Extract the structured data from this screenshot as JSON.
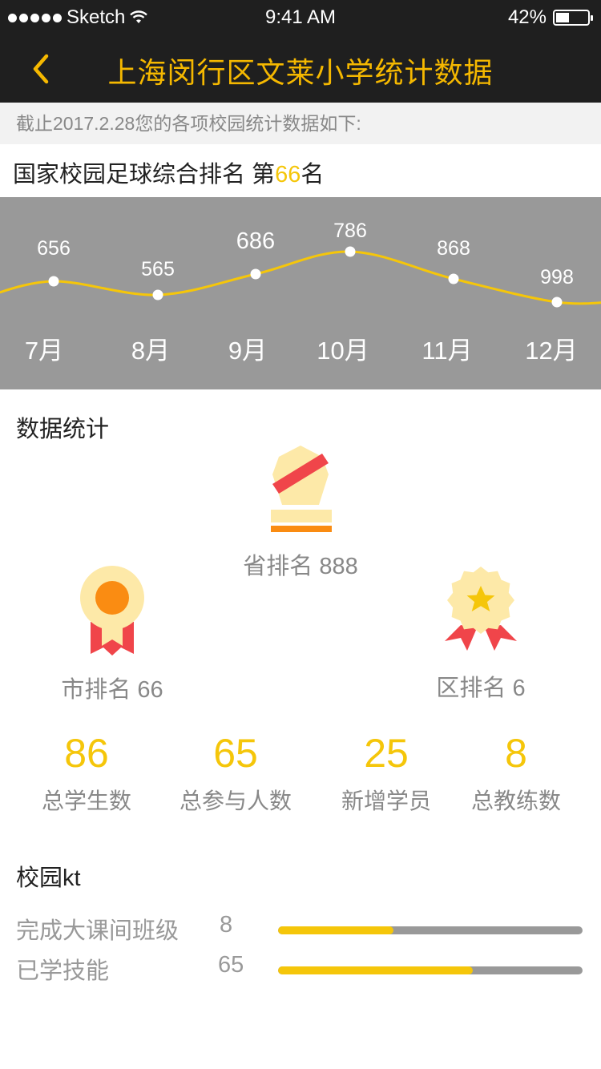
{
  "status": {
    "carrier": "Sketch",
    "time": "9:41 AM",
    "battery": "42%",
    "battery_level": 0.42
  },
  "nav": {
    "title": "上海闵行区文莱小学统计数据"
  },
  "subtitle": "截止2017.2.28您的各项校园统计数据如下:",
  "ranking": {
    "prefix": "国家校园足球综合排名 第",
    "rank": "66",
    "suffix": "名"
  },
  "chart_data": {
    "type": "line",
    "categories": [
      "7月",
      "8月",
      "9月",
      "10月",
      "11月",
      "12月"
    ],
    "values": [
      656,
      565,
      686,
      786,
      868,
      998
    ],
    "data_labels": [
      "656",
      "565",
      "686",
      "786",
      "868",
      "998"
    ]
  },
  "stats_section": {
    "title": "数据统计"
  },
  "awards": {
    "province": {
      "label": "省排名 888"
    },
    "city": {
      "label": "市排名 66"
    },
    "district": {
      "label": "区排名 6"
    }
  },
  "stats": [
    {
      "value": "86",
      "label": "总学生数"
    },
    {
      "value": "65",
      "label": "总参与人数"
    },
    {
      "value": "25",
      "label": "新增学员"
    },
    {
      "value": "8",
      "label": "总教练数"
    }
  ],
  "kt": {
    "title": "校园kt",
    "rows": [
      {
        "name": "完成大课间班级",
        "value": "8",
        "progress": 0.38
      },
      {
        "name": "已学技能",
        "value": "65",
        "progress": 0.64
      }
    ]
  },
  "colors": {
    "accent": "#f5c60a",
    "nav_bg": "#1f1f1f",
    "chart_bg": "#999999"
  }
}
